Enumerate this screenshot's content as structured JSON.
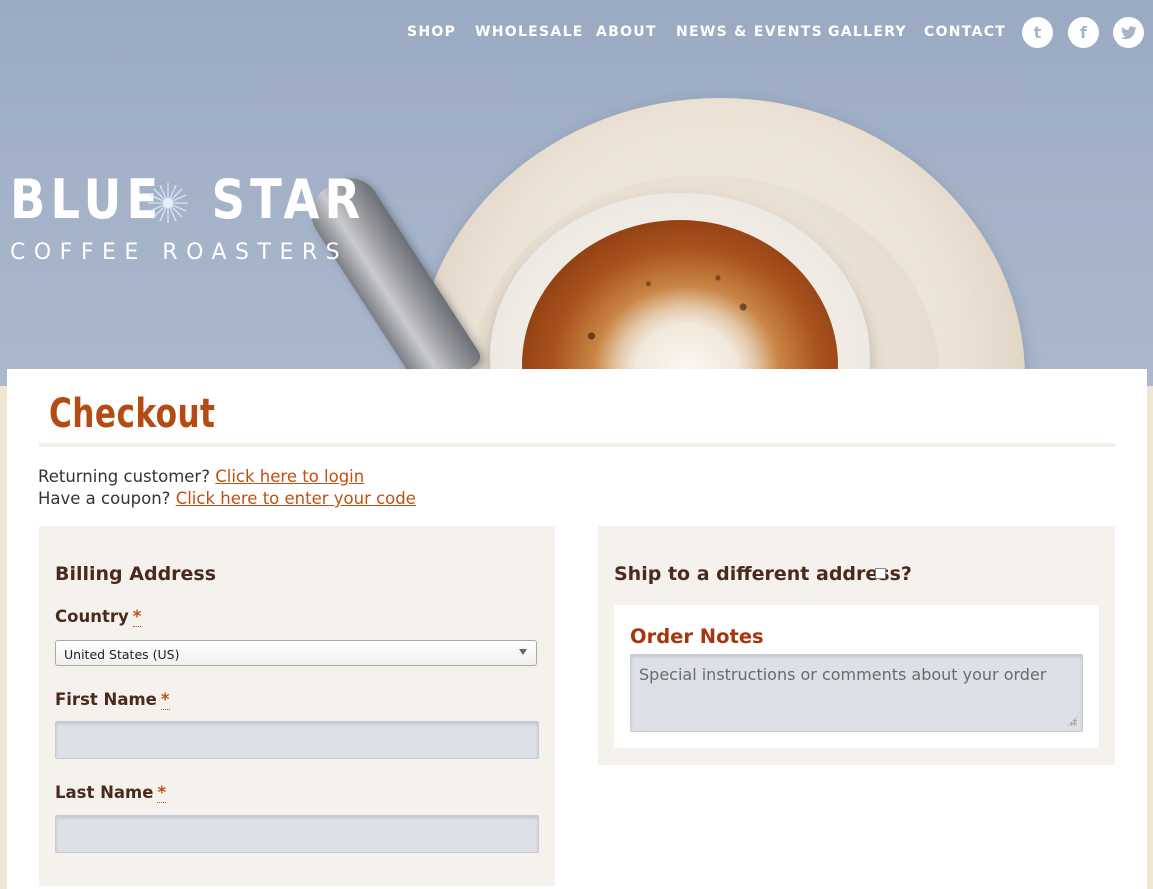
{
  "nav": {
    "items": [
      "SHOP",
      "WHOLESALE",
      "ABOUT",
      "NEWS & EVENTS",
      "GALLERY",
      "CONTACT"
    ],
    "social": [
      {
        "name": "tumblr-icon",
        "glyph": "t"
      },
      {
        "name": "facebook-icon",
        "glyph": "f"
      },
      {
        "name": "twitter-icon",
        "glyph": "twitter"
      }
    ]
  },
  "logo": {
    "line1_left": "BLUE",
    "line1_right": "STAR",
    "line2": "COFFEE ROASTERS"
  },
  "page": {
    "title": "Checkout"
  },
  "notices": {
    "returning_prefix": "Returning customer?",
    "returning_link": "Click here to login",
    "coupon_prefix": "Have a coupon?",
    "coupon_link": "Click here to enter your code"
  },
  "billing": {
    "heading": "Billing Address",
    "country_label": "Country",
    "country_value": "United States (US)",
    "first_name_label": "First Name",
    "last_name_label": "Last Name",
    "required_mark": "*"
  },
  "shipping": {
    "heading": "Ship to a different address?",
    "notes_title": "Order Notes",
    "notes_placeholder": "Special instructions or comments about your order"
  },
  "colors": {
    "accent": "#c05012",
    "heading": "#4a2a1f",
    "hero_bg": "#a3b2c8"
  }
}
